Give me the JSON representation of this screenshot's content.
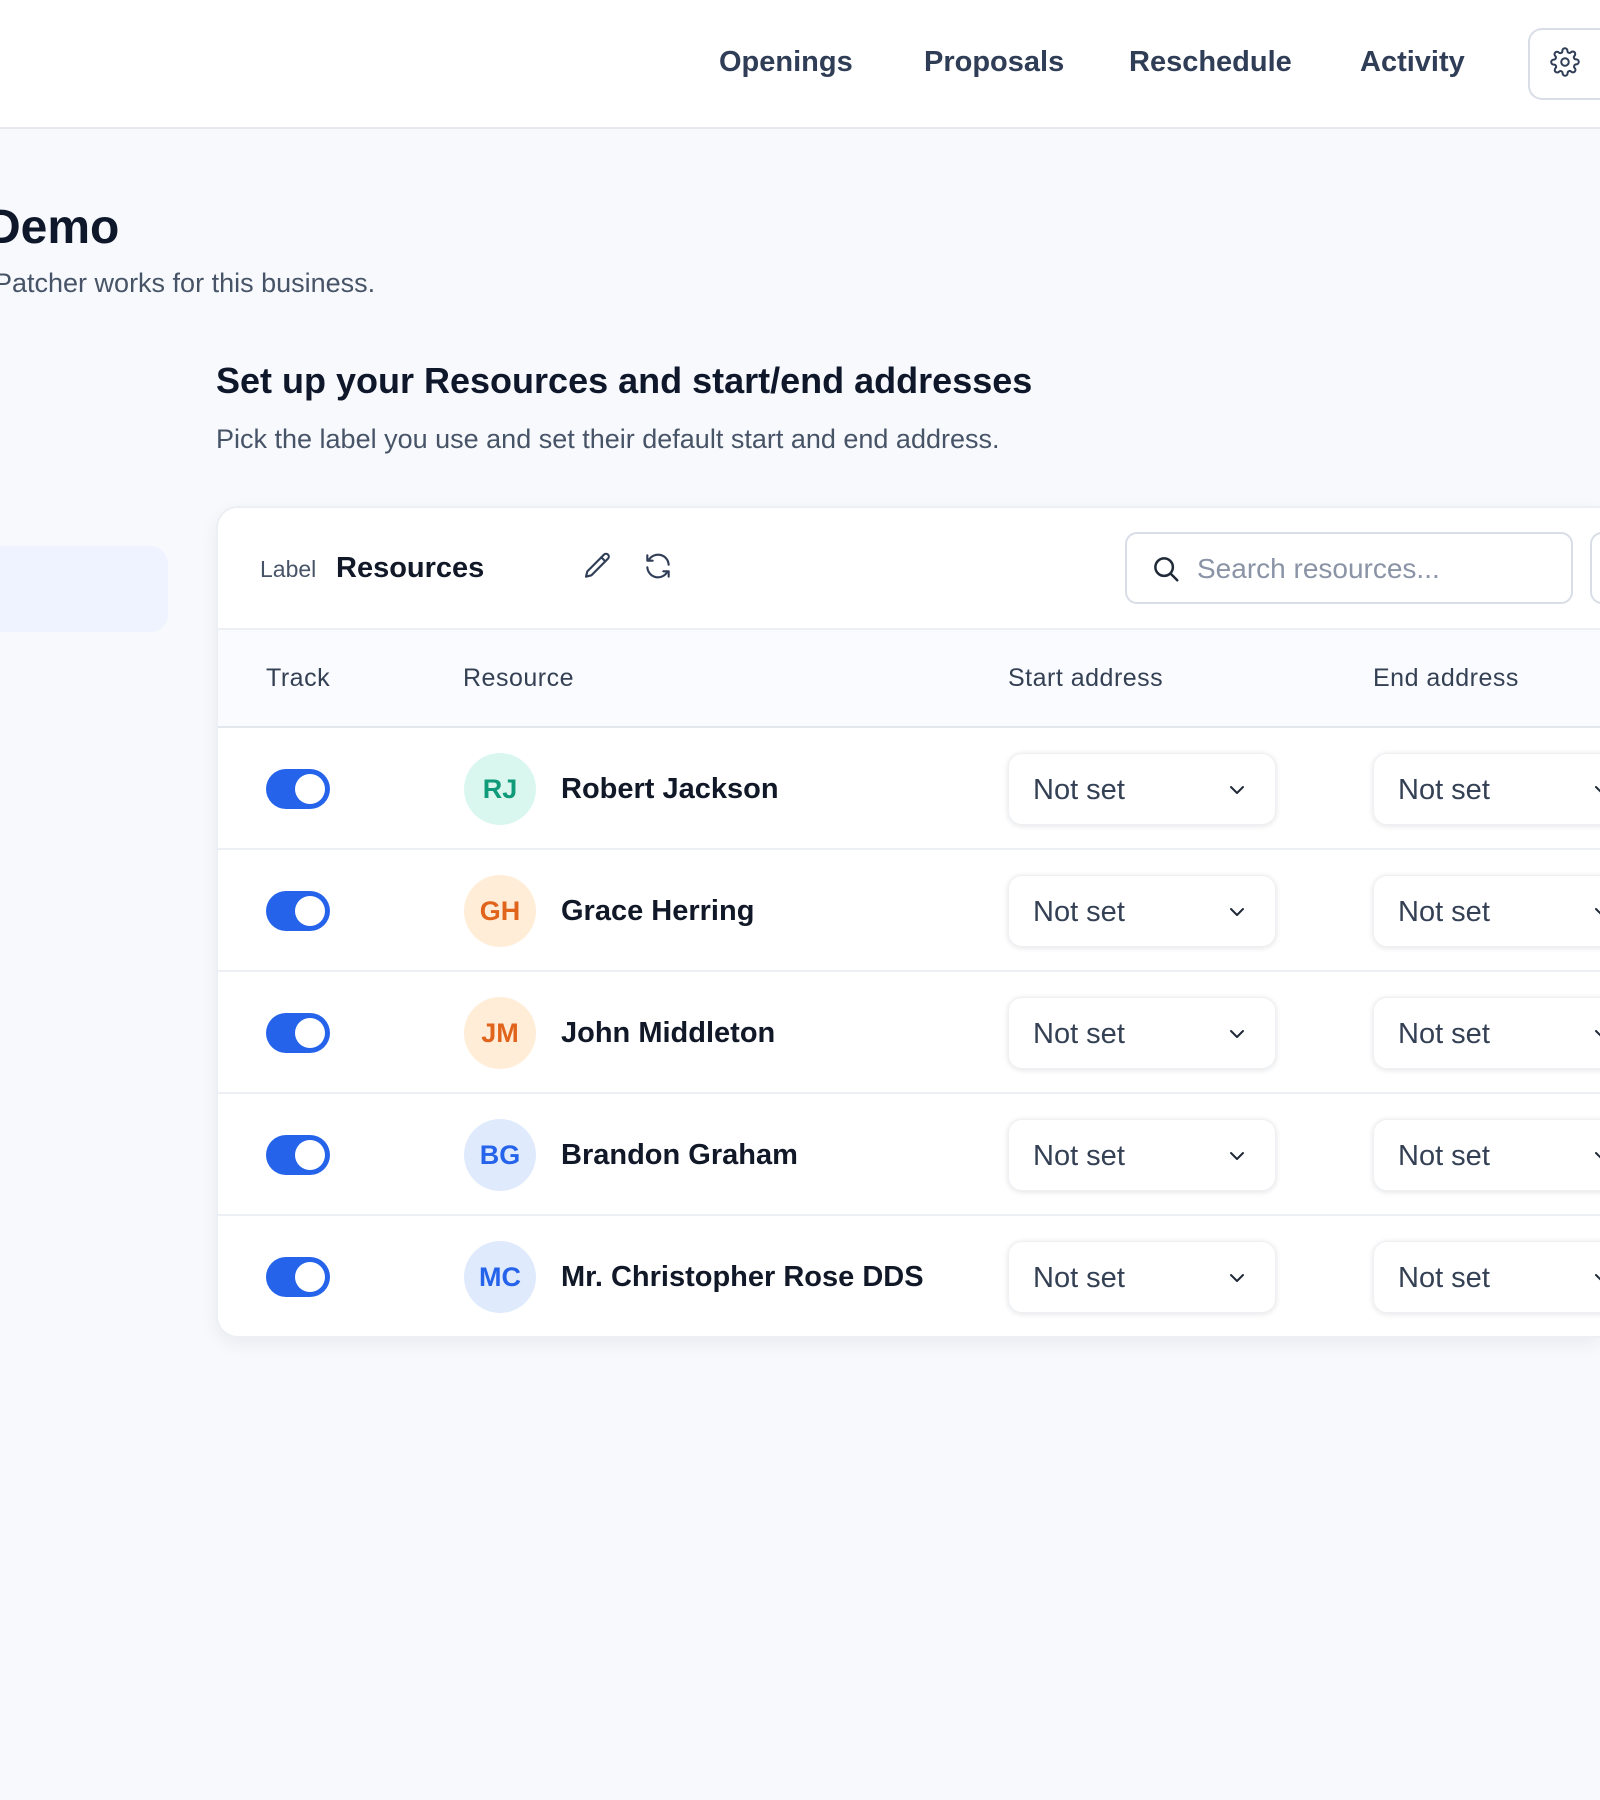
{
  "nav": {
    "items": [
      "Openings",
      "Proposals",
      "Reschedule",
      "Activity"
    ]
  },
  "page": {
    "title": "Demo",
    "subtitle": "Patcher works for this business."
  },
  "section": {
    "title": "Set up your Resources and start/end addresses",
    "description": "Pick the label you use and set their default start and end address."
  },
  "card": {
    "label_caption": "Label",
    "label_value": "Resources",
    "search_placeholder": "Search resources..."
  },
  "table": {
    "columns": [
      "Track",
      "Resource",
      "Start address",
      "End address"
    ],
    "rows": [
      {
        "tracked": true,
        "initials": "RJ",
        "name": "Robert Jackson",
        "start": "Not set",
        "end": "Not set",
        "avatar_bg": "#d9f7ef",
        "avatar_fg": "#0f9b7a"
      },
      {
        "tracked": true,
        "initials": "GH",
        "name": "Grace Herring",
        "start": "Not set",
        "end": "Not set",
        "avatar_bg": "#ffedd8",
        "avatar_fg": "#e0641b"
      },
      {
        "tracked": true,
        "initials": "JM",
        "name": "John Middleton",
        "start": "Not set",
        "end": "Not set",
        "avatar_bg": "#ffedd8",
        "avatar_fg": "#e0641b"
      },
      {
        "tracked": true,
        "initials": "BG",
        "name": "Brandon Graham",
        "start": "Not set",
        "end": "Not set",
        "avatar_bg": "#dfeafd",
        "avatar_fg": "#2563eb"
      },
      {
        "tracked": true,
        "initials": "MC",
        "name": "Mr. Christopher Rose DDS",
        "start": "Not set",
        "end": "Not set",
        "avatar_bg": "#dfeafd",
        "avatar_fg": "#2563eb"
      }
    ]
  },
  "colors": {
    "accent": "#2563eb",
    "background": "#f7f9fd"
  },
  "icons": {
    "settings": "gear-icon",
    "edit": "pencil-icon",
    "refresh": "refresh-icon",
    "search": "search-icon",
    "dropdown": "chevron-down-icon"
  }
}
